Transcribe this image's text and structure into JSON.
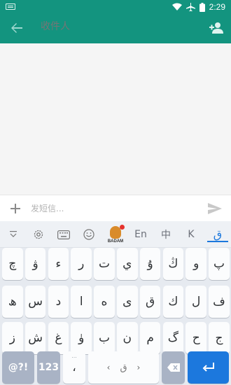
{
  "status_bar": {
    "time": "2:29",
    "icons": [
      "keyboard-icon",
      "wifi-icon",
      "airplane-icon",
      "battery-icon"
    ]
  },
  "app_bar": {
    "recipient_placeholder": "收件人",
    "back_icon": "arrow-left-icon",
    "add_contact_icon": "person-add-icon",
    "color": "#13947f"
  },
  "compose": {
    "placeholder": "发短信...",
    "attach_icon": "plus-icon",
    "send_icon": "send-icon"
  },
  "keyboard": {
    "toolbar": {
      "collapse_icon": "collapse-icon",
      "settings_icon": "gear-icon",
      "keyboard_icon": "keyboard-icon",
      "emoji_icon": "emoji-icon",
      "logo_text": "BADAM",
      "english": "En",
      "chinese": "中",
      "kazakh": "K",
      "uyghur": "ق"
    },
    "rows": [
      [
        "چ",
        "ۋ",
        "ء",
        "ر",
        "ت",
        "ي",
        "ۇ",
        "ڭ",
        "و",
        "پ"
      ],
      [
        "ھ",
        "س",
        "د",
        "ا",
        "ە",
        "ى",
        "ق",
        "ك",
        "ل",
        "ف"
      ],
      [
        "ز",
        "ش",
        "غ",
        "ۈ",
        "ب",
        "ن",
        "م",
        "گ",
        "ح",
        "ج"
      ]
    ],
    "row1_hints": [
      "",
      "",
      "",
      "",
      "",
      "",
      "",
      "",
      "",
      ""
    ],
    "bottom": {
      "symbols": "@?!",
      "numbers": "123",
      "comma": "،",
      "comma_hint": "...",
      "space_label": "ق",
      "space_left": "‹",
      "space_right": "›",
      "accent": "#1c78dd"
    }
  }
}
